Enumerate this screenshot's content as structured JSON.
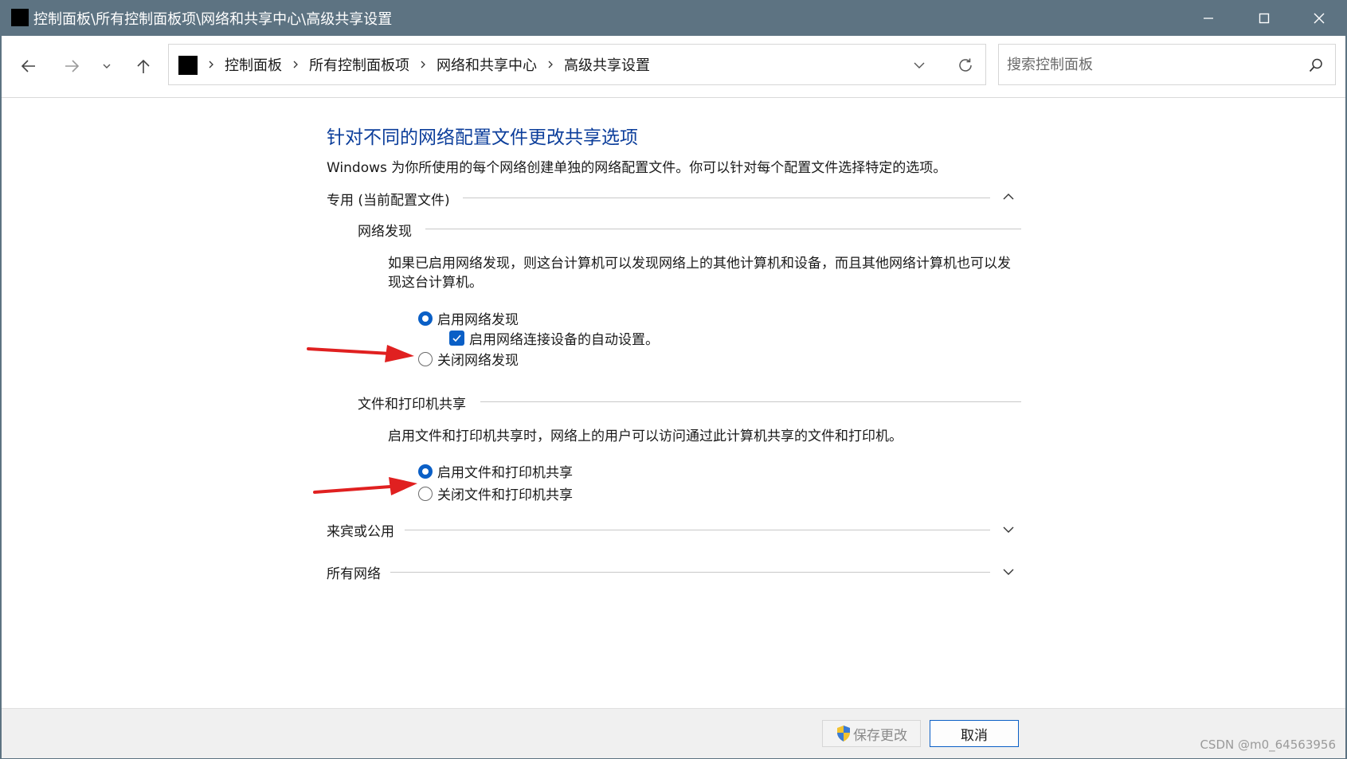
{
  "window": {
    "title": "控制面板\\所有控制面板项\\网络和共享中心\\高级共享设置",
    "controls": [
      "minimize-icon",
      "maximize-icon",
      "close-icon"
    ]
  },
  "nav": {
    "buttons": [
      "back-arrow-icon",
      "forward-arrow-icon",
      "recent-chevron-icon",
      "up-arrow-icon"
    ],
    "breadcrumbs": [
      "控制面板",
      "所有控制面板项",
      "网络和共享中心",
      "高级共享设置"
    ],
    "search_placeholder": "搜索控制面板"
  },
  "main": {
    "title": "针对不同的网络配置文件更改共享选项",
    "description": "Windows 为你所使用的每个网络创建单独的网络配置文件。你可以针对每个配置文件选择特定的选项。",
    "private_profile": {
      "label": "专用 (当前配置文件)",
      "expanded": true,
      "network_discovery": {
        "heading": "网络发现",
        "description": "如果已启用网络发现，则这台计算机可以发现网络上的其他计算机和设备，而且其他网络计算机也可以发现这台计算机。",
        "option_on": "启用网络发现",
        "auto_setup": "启用网络连接设备的自动设置。",
        "option_off": "关闭网络发现",
        "selected": "on",
        "auto_setup_checked": true
      },
      "file_printer_sharing": {
        "heading": "文件和打印机共享",
        "description": "启用文件和打印机共享时，网络上的用户可以访问通过此计算机共享的文件和打印机。",
        "option_on": "启用文件和打印机共享",
        "option_off": "关闭文件和打印机共享",
        "selected": "on"
      }
    },
    "guest_public": {
      "label": "来宾或公用",
      "expanded": false
    },
    "all_networks": {
      "label": "所有网络",
      "expanded": false
    }
  },
  "footer": {
    "save_label": "保存更改",
    "cancel_label": "取消",
    "watermark": "CSDN @m0_64563956"
  },
  "colors": {
    "titlebar": "#5d7382",
    "title_blue": "#0c3e9b",
    "accent": "#0a5fc6",
    "annotation_arrow": "#e02020"
  }
}
